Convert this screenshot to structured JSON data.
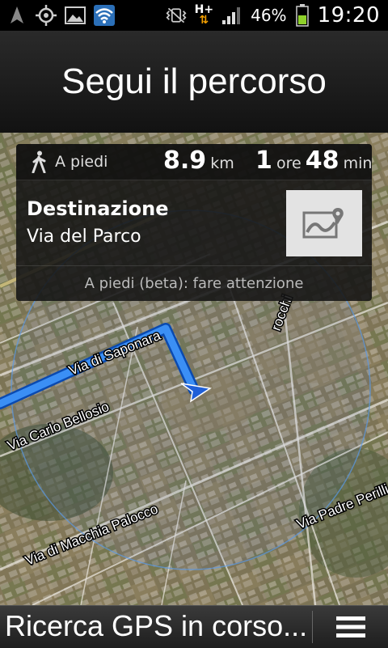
{
  "status_bar": {
    "battery_percent": "46%",
    "time": "19:20",
    "network": "H+",
    "icons": [
      "navigation-arrow-icon",
      "gps-icon",
      "image-icon",
      "wifi-icon",
      "mute-vibrate-icon",
      "signal-icon",
      "battery-icon"
    ]
  },
  "header": {
    "title": "Segui il percorso"
  },
  "card": {
    "mode_label": "A piedi",
    "distance_value": "8.9",
    "distance_unit": "km",
    "hours_value": "1",
    "hours_unit": "ore",
    "minutes_value": "48",
    "minutes_unit": "min",
    "destination_label": "Destinazione",
    "destination_value": "Via del Parco",
    "warning": "A piedi (beta): fare attenzione"
  },
  "map": {
    "street_labels": [
      "Via di Saponara",
      "Via Carlo Bellosio",
      "Via di Macchia Palocco",
      "Via Padre Perilli",
      "rocchi"
    ],
    "route_color": "#2a7fe8"
  },
  "bottom_bar": {
    "status": "Ricerca GPS in corso...",
    "menu_icon": "menu-icon"
  }
}
